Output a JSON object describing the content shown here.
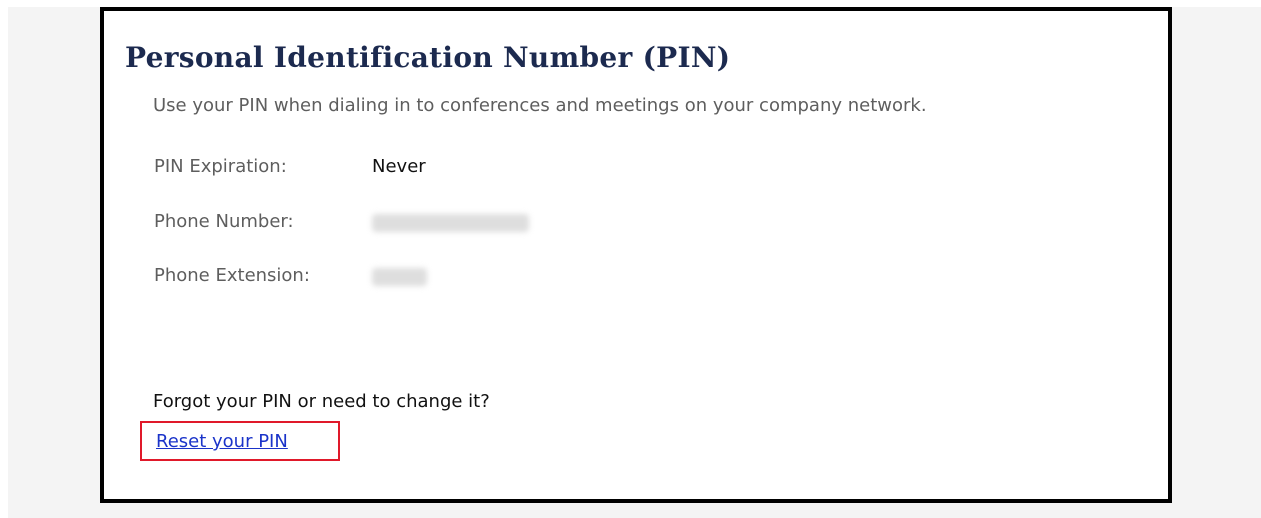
{
  "pin_section": {
    "title": "Personal Identification Number (PIN)",
    "description": "Use your PIN when dialing in to conferences and meetings on your company network.",
    "rows": [
      {
        "label": "PIN Expiration:",
        "value": "Never"
      },
      {
        "label": "Phone Number:",
        "value": ""
      },
      {
        "label": "Phone Extension:",
        "value": ""
      }
    ],
    "forgot_prompt": "Forgot your PIN or need to change it?",
    "reset_link_label": "Reset your PIN"
  },
  "colors": {
    "title": "#1c2a4f",
    "muted_text": "#5e5e5e",
    "link": "#1a33c9",
    "highlight_box": "#e0192a",
    "panel_border": "#000000",
    "backdrop": "#f4f4f4"
  }
}
